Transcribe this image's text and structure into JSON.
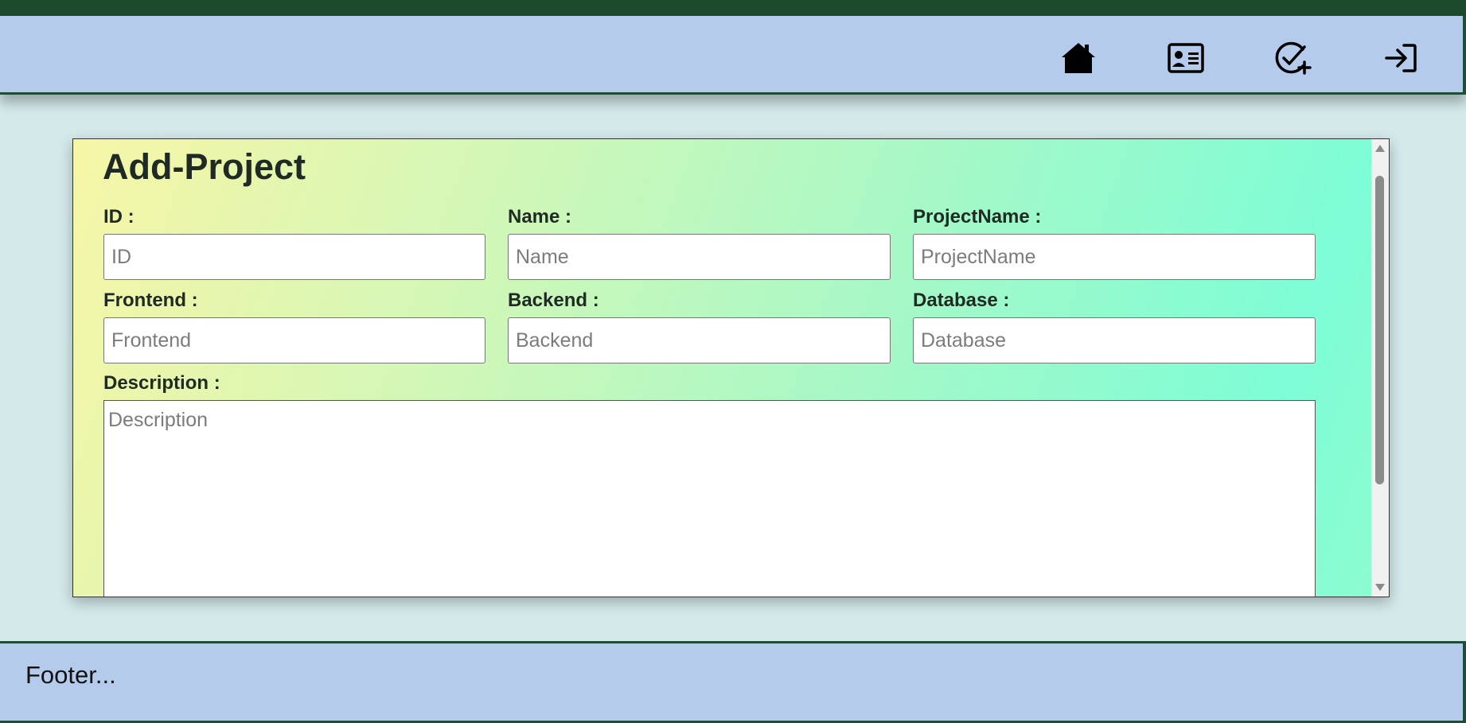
{
  "nav": {
    "icons": [
      "home-icon",
      "contact-card-icon",
      "add-task-icon",
      "login-icon"
    ]
  },
  "form": {
    "title": "Add-Project",
    "fields": {
      "id": {
        "label": "ID :",
        "placeholder": "ID",
        "value": ""
      },
      "name": {
        "label": "Name :",
        "placeholder": "Name",
        "value": ""
      },
      "project_name": {
        "label": "ProjectName :",
        "placeholder": "ProjectName",
        "value": ""
      },
      "frontend": {
        "label": "Frontend :",
        "placeholder": "Frontend",
        "value": ""
      },
      "backend": {
        "label": "Backend :",
        "placeholder": "Backend",
        "value": ""
      },
      "database": {
        "label": "Database :",
        "placeholder": "Database",
        "value": ""
      },
      "description": {
        "label": "Description :",
        "placeholder": "Description",
        "value": ""
      }
    }
  },
  "footer": {
    "text": "Footer..."
  },
  "colors": {
    "header_bg": "#b5cbec",
    "top_stripe": "#1d4a2a",
    "page_bg": "#d3e9ea",
    "gradient_start": "#f7f6a6",
    "gradient_end": "#7dfdd6"
  }
}
